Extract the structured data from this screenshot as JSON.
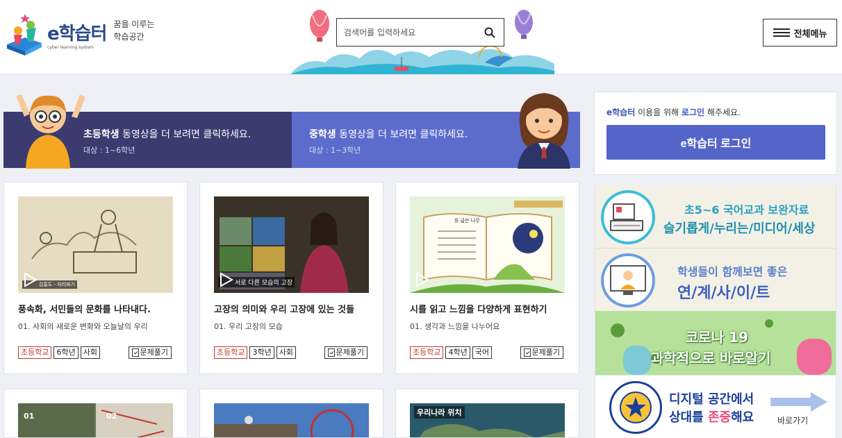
{
  "header": {
    "logo_name": "e학습터",
    "logo_sub": "cyber learning system",
    "slogan_line1": "꿈을 이루는",
    "slogan_line2": "학습공간",
    "search_placeholder": "검색어를 입력하세요",
    "menu_label": "전체메뉴"
  },
  "banner": {
    "elementary": {
      "title_bold": "초등학생",
      "title_rest": " 동영상을 더 보려면 클릭하세요.",
      "target": "대상 : 1~6학년"
    },
    "middle": {
      "title_bold": "중학생",
      "title_rest": " 동영상을 더 보려면 클릭하세요.",
      "target": "대상 : 1~3학년"
    }
  },
  "login": {
    "msg_brand": "e학습터",
    "msg_mid": " 이용을 위해 ",
    "msg_link": "로그인",
    "msg_end": " 해주세요.",
    "button": "e학습터 로그인"
  },
  "promos": [
    {
      "line1": "초5~6 국어교과 보완자료",
      "line2": "슬기롭게/누리는/미디어/세상",
      "color1": "#2a9fc0",
      "color2": "#1f8fb0"
    },
    {
      "line1": "학생들이 함께보면 좋은",
      "line2": "연/계/사/이/트",
      "color1": "#5b7fd0",
      "color2": "#3b5fc0"
    },
    {
      "line1": "코로나 19",
      "line2": "과학적으로 바로알기",
      "color1": "#ffffff",
      "color2": "#ffffff"
    },
    {
      "line1": "디지털 공간에서",
      "line2": "상대를 존중해요",
      "highlight": "존중",
      "link": "바로가기",
      "color1": "#1a3f9a"
    }
  ],
  "cards": [
    {
      "title": "풍속화, 서민들의 문화를 나타내다.",
      "unit": "01. 사회의 새로운 변화와 오늘날의 우리",
      "tags": [
        "초등학교",
        "6학년",
        "사회"
      ],
      "quiz": "문제풀기",
      "thumb_caption": "김홍도 - 자리짜기"
    },
    {
      "title": "고장의 의미와 우리 고장에 있는 것들",
      "unit": "01. 우리 고장의 모습",
      "tags": [
        "초등학교",
        "3학년",
        "사회"
      ],
      "quiz": "문제풀기",
      "thumb_caption": "서로 다른 모습의 고장"
    },
    {
      "title": "시를 읽고 느낌을 다양하게 표현하기",
      "unit": "01. 생각과 느낌을 나누어요",
      "tags": [
        "초등학교",
        "4학년",
        "국어"
      ],
      "quiz": "문제풀기",
      "thumb_caption": "등 굽은 나무"
    }
  ],
  "cards_row2": [
    {
      "thumb_caption": "01 02"
    },
    {
      "thumb_caption": ""
    },
    {
      "thumb_caption": "우리나라 위치"
    }
  ]
}
